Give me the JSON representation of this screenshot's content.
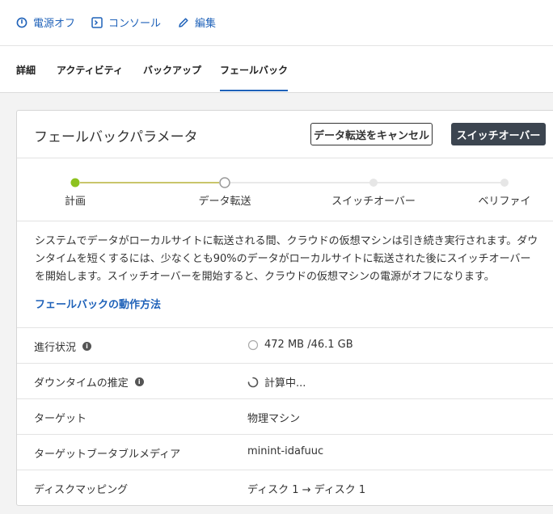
{
  "toolbar": {
    "power_off": "電源オフ",
    "console": "コンソール",
    "edit": "編集"
  },
  "tabs": [
    "詳細",
    "アクティビティ",
    "バックアップ",
    "フェールバック"
  ],
  "card": {
    "title": "フェールバックパラメータ",
    "cancel_transfer": "データ転送をキャンセル",
    "switchover": "スイッチオーバー"
  },
  "steps": [
    {
      "label": "計画",
      "state": "complete"
    },
    {
      "label": "データ転送",
      "state": "current"
    },
    {
      "label": "スイッチオーバー",
      "state": "pending"
    },
    {
      "label": "ベリファイ",
      "state": "pending"
    }
  ],
  "description": "システムでデータがローカルサイトに転送される間、クラウドの仮想マシンは引き続き実行されます。ダウンタイムを短くするには、少なくとも90%のデータがローカルサイトに転送された後にスイッチオーバーを開始します。スイッチオーバーを開始すると、クラウドの仮想マシンの電源がオフになります。",
  "help_link": "フェールバックの動作方法",
  "rows": [
    {
      "label": "進行状況",
      "value": "472 MB /46.1 GB"
    },
    {
      "label": "ダウンタイムの推定",
      "value": "計算中..."
    },
    {
      "label": "ターゲット",
      "value": "物理マシン"
    },
    {
      "label": "ターゲットブータブルメディア",
      "value": "minint-idafuuc"
    },
    {
      "label": "ディスクマッピング",
      "value": "ディスク 1 → ディスク 1"
    }
  ],
  "colors": {
    "accent": "#1f62b9",
    "complete": "#8dc21f",
    "dark_button": "#3c4550"
  }
}
